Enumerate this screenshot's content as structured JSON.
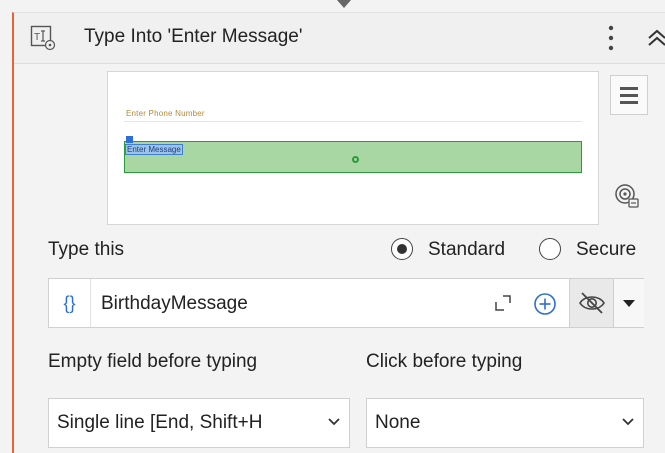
{
  "activity": {
    "title": "Type Into 'Enter Message'",
    "icon": "type-into-icon",
    "accent_color": "#e8623c"
  },
  "preview": {
    "page_title": "Enter Phone Number",
    "field_label": "Enter Message"
  },
  "type_this": {
    "label": "Type this",
    "mode_standard": "Standard",
    "mode_secure": "Secure",
    "selected_mode": "Standard",
    "variable_badge": "{}",
    "value": "BirthdayMessage"
  },
  "empty_field": {
    "label": "Empty field before typing",
    "value": "Single line [End, Shift+H"
  },
  "click_before": {
    "label": "Click before typing",
    "value": "None"
  }
}
